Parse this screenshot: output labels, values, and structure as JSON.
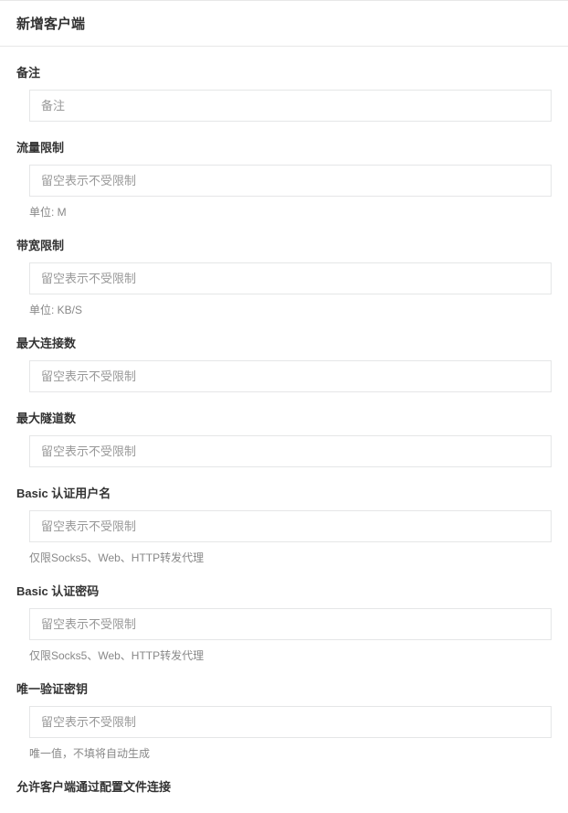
{
  "header": {
    "title": "新增客户端"
  },
  "fields": {
    "remark": {
      "label": "备注",
      "placeholder": "备注"
    },
    "flow_limit": {
      "label": "流量限制",
      "placeholder": "留空表示不受限制",
      "help": "单位: M"
    },
    "bandwidth_limit": {
      "label": "带宽限制",
      "placeholder": "留空表示不受限制",
      "help": "单位: KB/S"
    },
    "max_conn": {
      "label": "最大连接数",
      "placeholder": "留空表示不受限制"
    },
    "max_tunnel": {
      "label": "最大隧道数",
      "placeholder": "留空表示不受限制"
    },
    "basic_user": {
      "label": "Basic 认证用户名",
      "placeholder": "留空表示不受限制",
      "help": "仅限Socks5、Web、HTTP转发代理"
    },
    "basic_pass": {
      "label": "Basic 认证密码",
      "placeholder": "留空表示不受限制",
      "help": "仅限Socks5、Web、HTTP转发代理"
    },
    "verify_key": {
      "label": "唯一验证密钥",
      "placeholder": "留空表示不受限制",
      "help": "唯一值，不填将自动生成"
    },
    "allow_config": {
      "label": "允许客户端通过配置文件连接"
    }
  }
}
